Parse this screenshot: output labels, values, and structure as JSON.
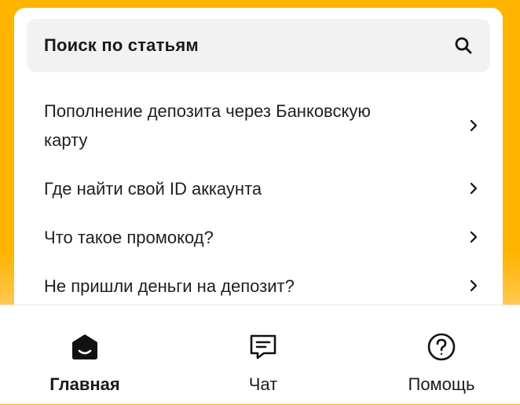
{
  "search": {
    "label": "Поиск по статьям",
    "icon": "search-icon"
  },
  "articles": [
    {
      "title": "Пополнение депозита через Банковскую карту"
    },
    {
      "title": "Где найти свой ID аккаунта"
    },
    {
      "title": "Что такое промокод?"
    },
    {
      "title": "Не пришли деньги на депозит?"
    }
  ],
  "nav": {
    "home": {
      "label": "Главная",
      "icon": "home-icon",
      "active": true
    },
    "chat": {
      "label": "Чат",
      "icon": "chat-icon"
    },
    "help": {
      "label": "Помощь",
      "icon": "help-icon"
    }
  },
  "colors": {
    "accent": "#ffb400",
    "text": "#1a1a1a",
    "search_bg": "#f2f2f2"
  }
}
